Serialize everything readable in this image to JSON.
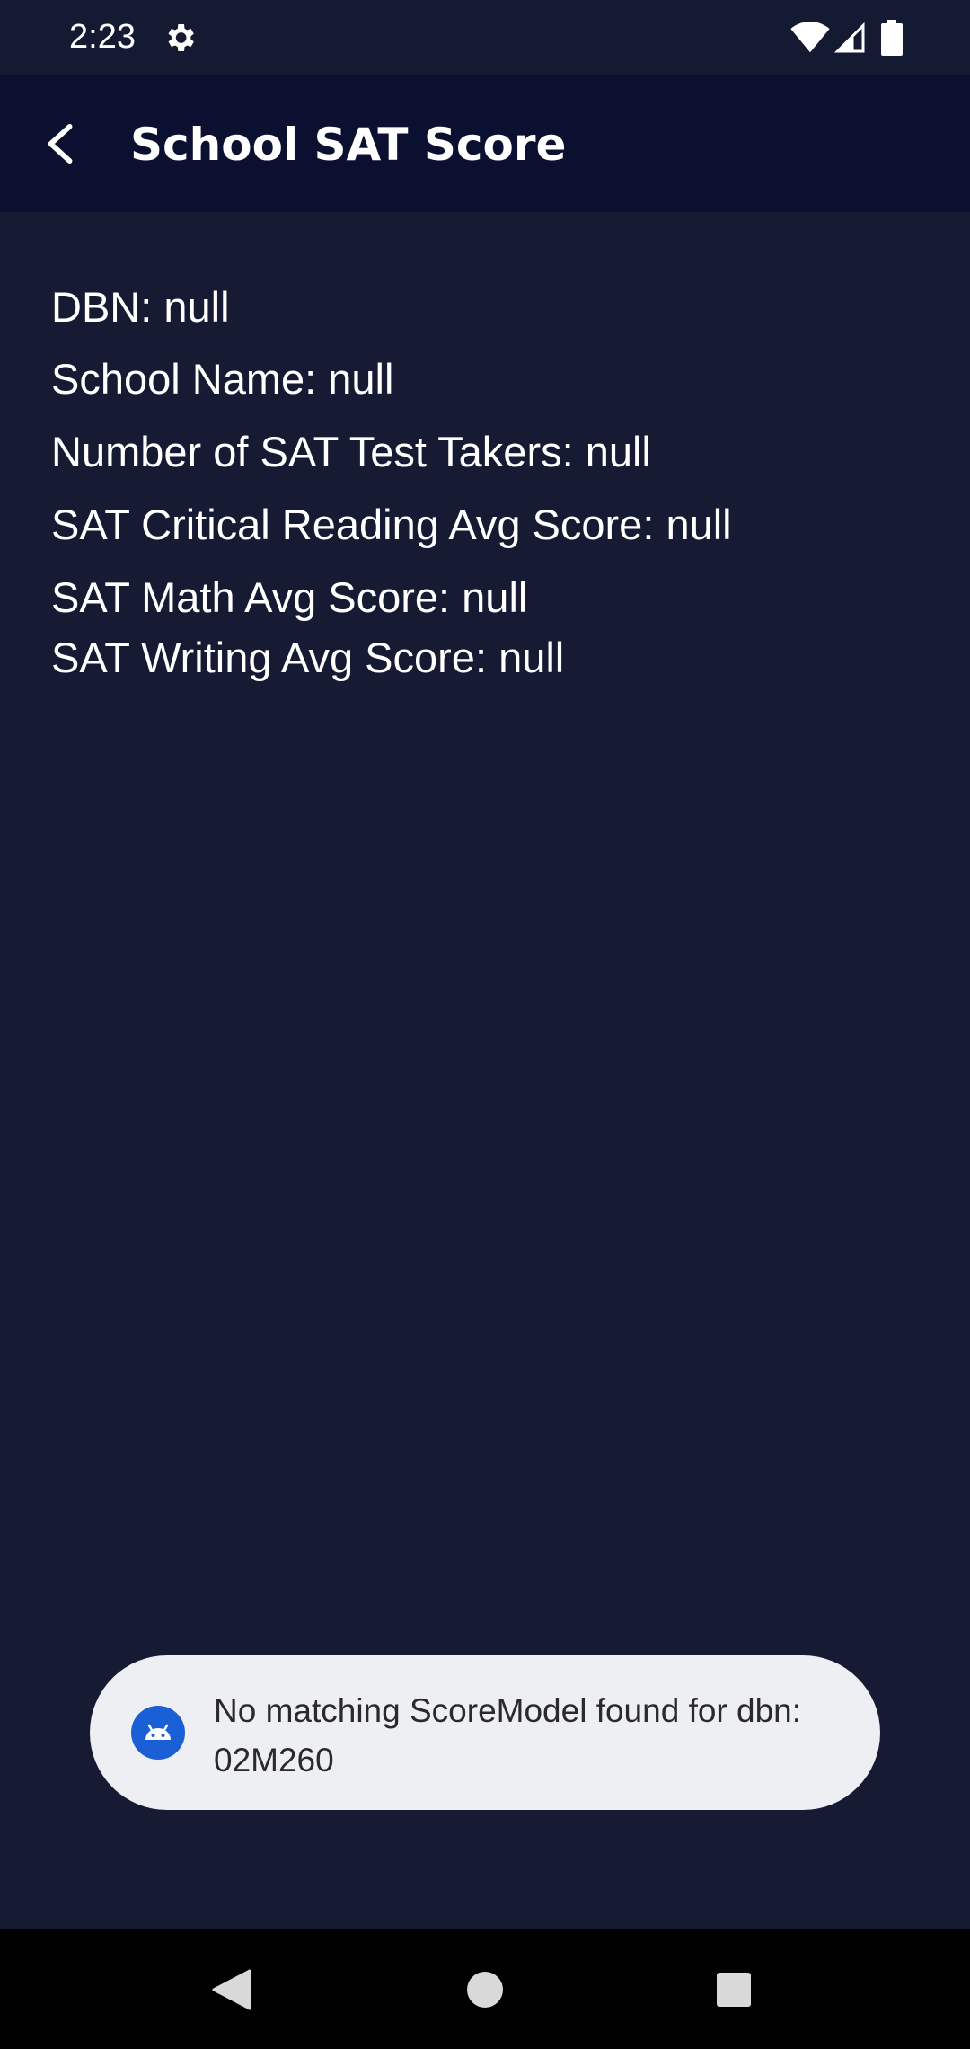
{
  "status_bar": {
    "time": "2:23"
  },
  "app_bar": {
    "title": "School SAT Score"
  },
  "details": {
    "dbn": "DBN: null",
    "school_name": "School Name: null",
    "test_takers": "Number of SAT Test Takers: null",
    "critical_reading": "SAT Critical Reading Avg Score: null",
    "math": "SAT Math Avg Score: null",
    "writing": "SAT Writing Avg Score: null"
  },
  "toast": {
    "message": "No matching ScoreModel found for dbn: 02M260"
  },
  "colors": {
    "background": "#161a33",
    "app_bar": "#0b1030",
    "toast_bg": "#eeeff2",
    "toast_icon": "#1a5fd6"
  }
}
